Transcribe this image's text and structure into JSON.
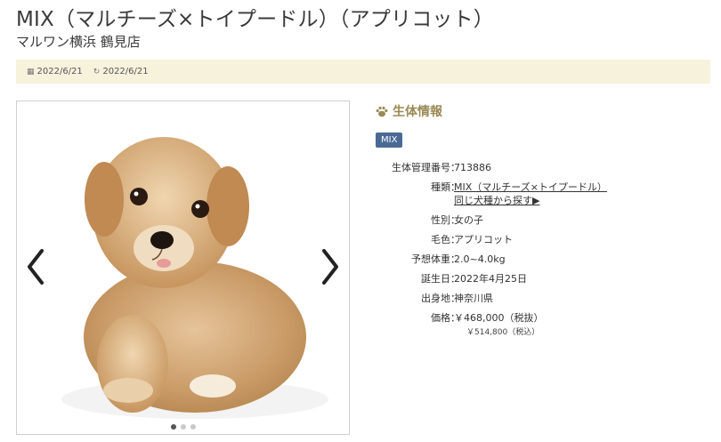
{
  "title": "MIX（マルチーズ×トイプードル）（アプリコット）",
  "shop": "マルワン横浜 鶴見店",
  "dates": {
    "published": "2022/6/21",
    "updated": "2022/6/21",
    "published_icon": "calendar-icon",
    "updated_icon": "refresh-icon"
  },
  "gallery": {
    "prev_icon": "chevron-left-icon",
    "next_icon": "chevron-right-icon",
    "slide_count": 3,
    "active_slide": 1
  },
  "info": {
    "heading": "生体情報",
    "heading_icon": "paw-icon",
    "badge": "MIX",
    "rows": [
      {
        "label": "生体管理番号",
        "value": "713886"
      },
      {
        "label": "種類",
        "value": "MIX（マルチーズ×トイプードル）",
        "link": "同じ犬種から探す▶"
      },
      {
        "label": "性別",
        "value": "女の子"
      },
      {
        "label": "毛色",
        "value": "アプリコット"
      },
      {
        "label": "予想体重",
        "value": "2.0~4.0kg"
      },
      {
        "label": "誕生日",
        "value": "2022年4月25日"
      },
      {
        "label": "出身地",
        "value": "神奈川県"
      },
      {
        "label": "価格",
        "value": "￥468,000（税抜）",
        "tax_included": "￥514,800（税込）"
      }
    ]
  },
  "colors": {
    "date_bar_bg": "#f7f2dc",
    "heading": "#9a8a55",
    "badge_bg": "#4a6a95"
  }
}
